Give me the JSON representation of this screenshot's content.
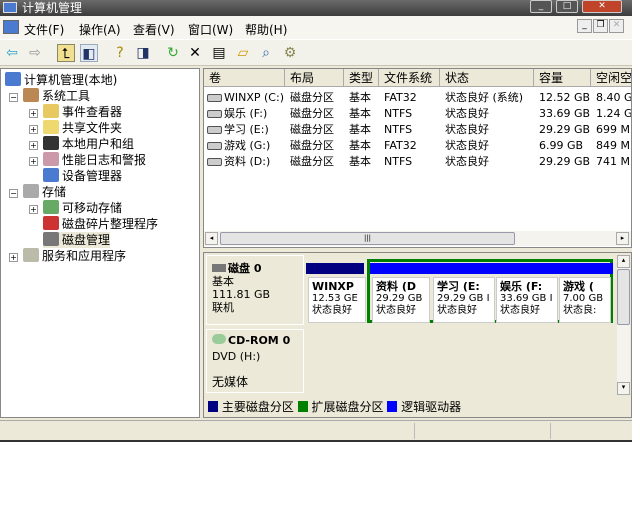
{
  "window": {
    "title": "计算机管理"
  },
  "menu": [
    "文件(F)",
    "操作(A)",
    "查看(V)",
    "窗口(W)",
    "帮助(H)"
  ],
  "toolbar": [
    "back-icon",
    "forward-icon",
    "up-icon",
    "show-hide-tree-icon",
    "help-icon",
    "show-hide-action-icon",
    "refresh-icon",
    "delete-icon",
    "properties-icon",
    "open-icon",
    "search-icon",
    "settings-icon"
  ],
  "tree": {
    "root": "计算机管理(本地)",
    "system_tools": "系统工具",
    "event_viewer": "事件查看器",
    "shared_folders": "共享文件夹",
    "local_users": "本地用户和组",
    "perf_logs": "性能日志和警报",
    "device_manager": "设备管理器",
    "storage": "存储",
    "removable": "可移动存储",
    "defrag": "磁盘碎片整理程序",
    "disk_mgmt": "磁盘管理",
    "services": "服务和应用程序"
  },
  "volumes": {
    "columns": [
      "卷",
      "布局",
      "类型",
      "文件系统",
      "状态",
      "容量",
      "空闲空"
    ],
    "rows": [
      [
        "WINXP (C:)",
        "磁盘分区",
        "基本",
        "FAT32",
        "状态良好 (系统)",
        "12.52 GB",
        "8.40 G"
      ],
      [
        "娱乐 (F:)",
        "磁盘分区",
        "基本",
        "NTFS",
        "状态良好",
        "33.69 GB",
        "1.24 G"
      ],
      [
        "学习 (E:)",
        "磁盘分区",
        "基本",
        "NTFS",
        "状态良好",
        "29.29 GB",
        "699 MB"
      ],
      [
        "游戏 (G:)",
        "磁盘分区",
        "基本",
        "FAT32",
        "状态良好",
        "6.99 GB",
        "849 MB"
      ],
      [
        "资料 (D:)",
        "磁盘分区",
        "基本",
        "NTFS",
        "状态良好",
        "29.29 GB",
        "741 MB"
      ]
    ]
  },
  "disk0": {
    "name": "磁盘 0",
    "type": "基本",
    "size": "111.81 GB",
    "state": "联机",
    "partitions": [
      {
        "name": "WINXP",
        "size": "12.53 GE",
        "status": "状态良好"
      },
      {
        "name": "资料 (D",
        "size": "29.29 GB",
        "status": "状态良好"
      },
      {
        "name": "学习 (E:",
        "size": "29.29 GB I",
        "status": "状态良好"
      },
      {
        "name": "娱乐 (F:",
        "size": "33.69 GB I",
        "status": "状态良好"
      },
      {
        "name": "游戏 (",
        "size": "7.00 GB",
        "status": "状态良:"
      }
    ]
  },
  "cdrom": {
    "name": "CD-ROM 0",
    "drive": "DVD (H:)",
    "media": "无媒体"
  },
  "legend": [
    "主要磁盘分区",
    "扩展磁盘分区",
    "逻辑驱动器"
  ],
  "colors": {
    "primary": "#000080",
    "extended": "#008000",
    "logical": "#0000ff"
  }
}
